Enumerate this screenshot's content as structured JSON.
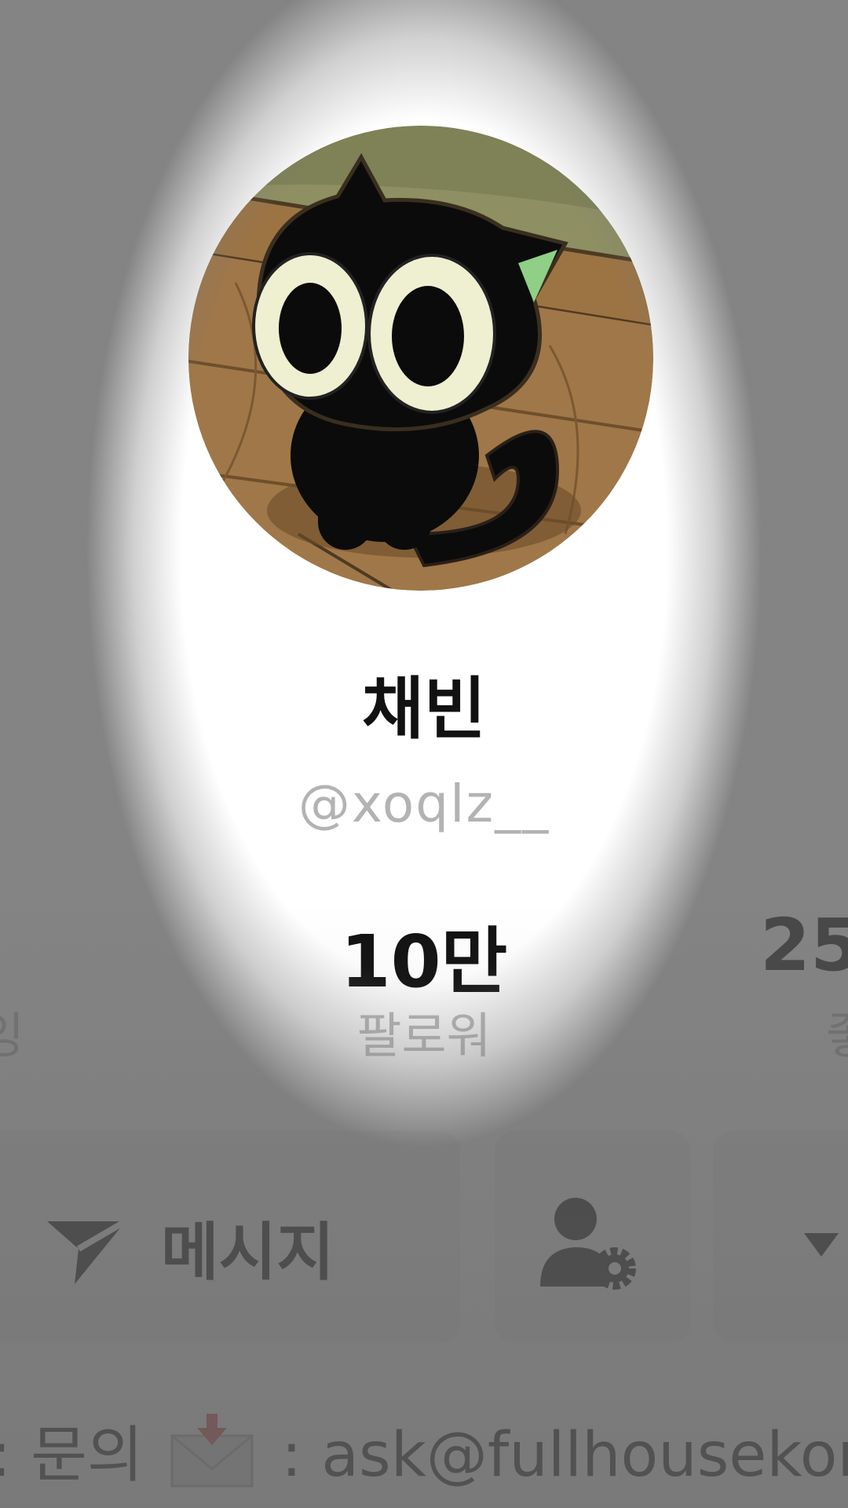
{
  "profile": {
    "display_name": "채빈",
    "username": "@xoqlz__",
    "avatar_icon": "black-cat-avatar"
  },
  "stats": {
    "left": {
      "label_fragment": "잉"
    },
    "center": {
      "value": "10만",
      "label": "팔로워"
    },
    "right": {
      "value_fragment": "25",
      "label_fragment": "좋"
    }
  },
  "actions": {
    "message_label": "메시지",
    "message_icon": "send-icon",
    "follow_settings_icon": "person-settings-icon",
    "more_icon": "caret-down-icon"
  },
  "bio": {
    "prefix": ": 문의",
    "envelope_icon": "envelope-icon",
    "contact": ": ask@fullhousekor"
  }
}
